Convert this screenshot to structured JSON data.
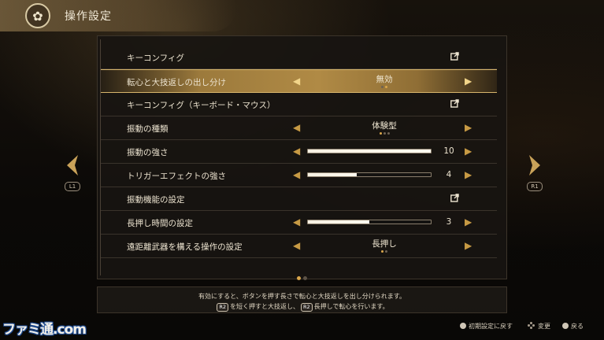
{
  "header": {
    "title": "操作設定",
    "emblem_icon": "clan-crest-icon"
  },
  "rows": [
    {
      "label": "キーコンフィグ",
      "type": "link"
    },
    {
      "label": "転心と大技返しの出し分け",
      "type": "select",
      "value": "無効",
      "options_count": 2,
      "selected_index": 1,
      "active": true
    },
    {
      "label": "キーコンフィグ（キーボード・マウス）",
      "type": "link"
    },
    {
      "label": "振動の種類",
      "type": "select",
      "value": "体験型",
      "options_count": 3,
      "selected_index": 0
    },
    {
      "label": "振動の強さ",
      "type": "slider",
      "value": "10",
      "fraction": 1.0
    },
    {
      "label": "トリガーエフェクトの強さ",
      "type": "slider",
      "value": "4",
      "fraction": 0.4
    },
    {
      "label": "振動機能の設定",
      "type": "link"
    },
    {
      "label": "長押し時間の設定",
      "type": "slider",
      "value": "3",
      "fraction": 0.5
    },
    {
      "label": "遠距離武器を構える操作の設定",
      "type": "select",
      "value": "長押し",
      "options_count": 2,
      "selected_index": 0
    }
  ],
  "pager": {
    "pages": 2,
    "current": 0
  },
  "nav": {
    "left_bumper": "L1",
    "right_bumper": "R1"
  },
  "description": {
    "line1": "有効にすると、ボタンを押す長さで転心と大技返しを出し分けられます。",
    "btn": "R2",
    "part_a": "を短く押すと大技返し、",
    "part_b": "長押しで転心を行います。"
  },
  "hints": {
    "reset": "初期設定に戻す",
    "change": "変更",
    "back": "戻る"
  },
  "watermark": "ファミ通.com",
  "colors": {
    "accent": "#c79a44",
    "highlight": "#b08a45"
  }
}
